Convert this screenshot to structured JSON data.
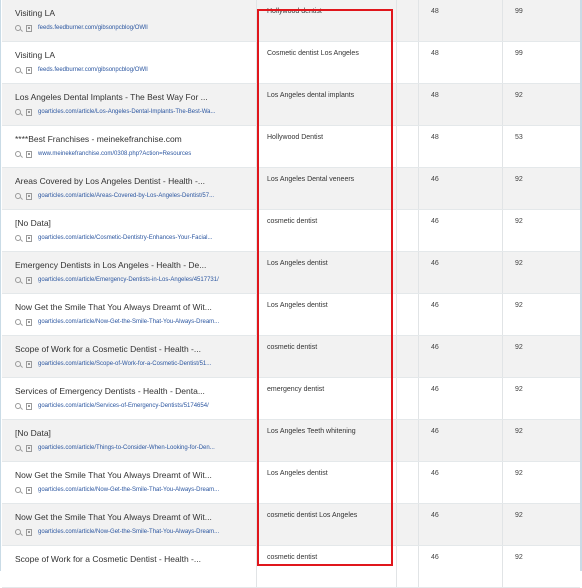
{
  "rows": [
    {
      "title": "Visiting LA",
      "url": "feeds.feedburner.com/gibsonpcblog/OWll",
      "keyword": "Hollywood dentist",
      "col_a": "48",
      "col_b": "99"
    },
    {
      "title": "Visiting LA",
      "url": "feeds.feedburner.com/gibsonpcblog/OWll",
      "keyword": "Cosmetic dentist Los Angeles",
      "col_a": "48",
      "col_b": "99"
    },
    {
      "title": "Los Angeles Dental Implants - The Best Way For ...",
      "url": "goarticles.com/article/Los-Angeles-Dental-Implants-The-Best-Wa...",
      "keyword": "Los Angeles dental implants",
      "col_a": "48",
      "col_b": "92"
    },
    {
      "title": "****Best Franchises - meinekefranchise.com",
      "url": "www.meinekefranchise.com/0308.php?Action=Resources",
      "keyword": "Hollywood Dentist",
      "col_a": "48",
      "col_b": "53"
    },
    {
      "title": "Areas Covered by Los Angeles Dentist - Health -...",
      "url": "goarticles.com/article/Areas-Covered-by-Los-Angeles-Dentist/57...",
      "keyword": "Los Angeles Dental veneers",
      "col_a": "46",
      "col_b": "92"
    },
    {
      "title": "[No Data]",
      "url": "goarticles.com/article/Cosmetic-Dentistry-Enhances-Your-Facial...",
      "keyword": "cosmetic dentist",
      "col_a": "46",
      "col_b": "92"
    },
    {
      "title": "Emergency Dentists in Los Angeles - Health - De...",
      "url": "goarticles.com/article/Emergency-Dentists-in-Los-Angeles/4517731/",
      "keyword": "Los Angeles dentist",
      "col_a": "46",
      "col_b": "92"
    },
    {
      "title": "Now Get the Smile That You Always Dreamt of Wit...",
      "url": "goarticles.com/article/Now-Get-the-Smile-That-You-Always-Dream...",
      "keyword": "Los Angeles dentist",
      "col_a": "46",
      "col_b": "92"
    },
    {
      "title": "Scope of Work for a Cosmetic Dentist - Health -...",
      "url": "goarticles.com/article/Scope-of-Work-for-a-Cosmetic-Dentist/51...",
      "keyword": "cosmetic dentist",
      "col_a": "46",
      "col_b": "92"
    },
    {
      "title": "Services of Emergency Dentists - Health - Denta...",
      "url": "goarticles.com/article/Services-of-Emergency-Dentists/5174654/",
      "keyword": "emergency dentist",
      "col_a": "46",
      "col_b": "92"
    },
    {
      "title": "[No Data]",
      "url": "goarticles.com/article/Things-to-Consider-When-Looking-for-Den...",
      "keyword": "Los Angeles Teeth whitening",
      "col_a": "46",
      "col_b": "92"
    },
    {
      "title": "Now Get the Smile That You Always Dreamt of Wit...",
      "url": "goarticles.com/article/Now-Get-the-Smile-That-You-Always-Dream...",
      "keyword": "Los Angeles dentist",
      "col_a": "46",
      "col_b": "92"
    },
    {
      "title": "Now Get the Smile That You Always Dreamt of Wit...",
      "url": "goarticles.com/article/Now-Get-the-Smile-That-You-Always-Dream...",
      "keyword": "cosmetic dentist Los Angeles",
      "col_a": "46",
      "col_b": "92"
    },
    {
      "title": "Scope of Work for a Cosmetic Dentist - Health -...",
      "url": "",
      "keyword": "cosmetic dentist",
      "col_a": "46",
      "col_b": "92"
    }
  ],
  "icons": {
    "search": "magnifier-icon",
    "feed": "page-icon"
  },
  "colors": {
    "highlight": "#e0161c",
    "link": "#2b56a0",
    "row_alt": "#f2f2f2"
  }
}
